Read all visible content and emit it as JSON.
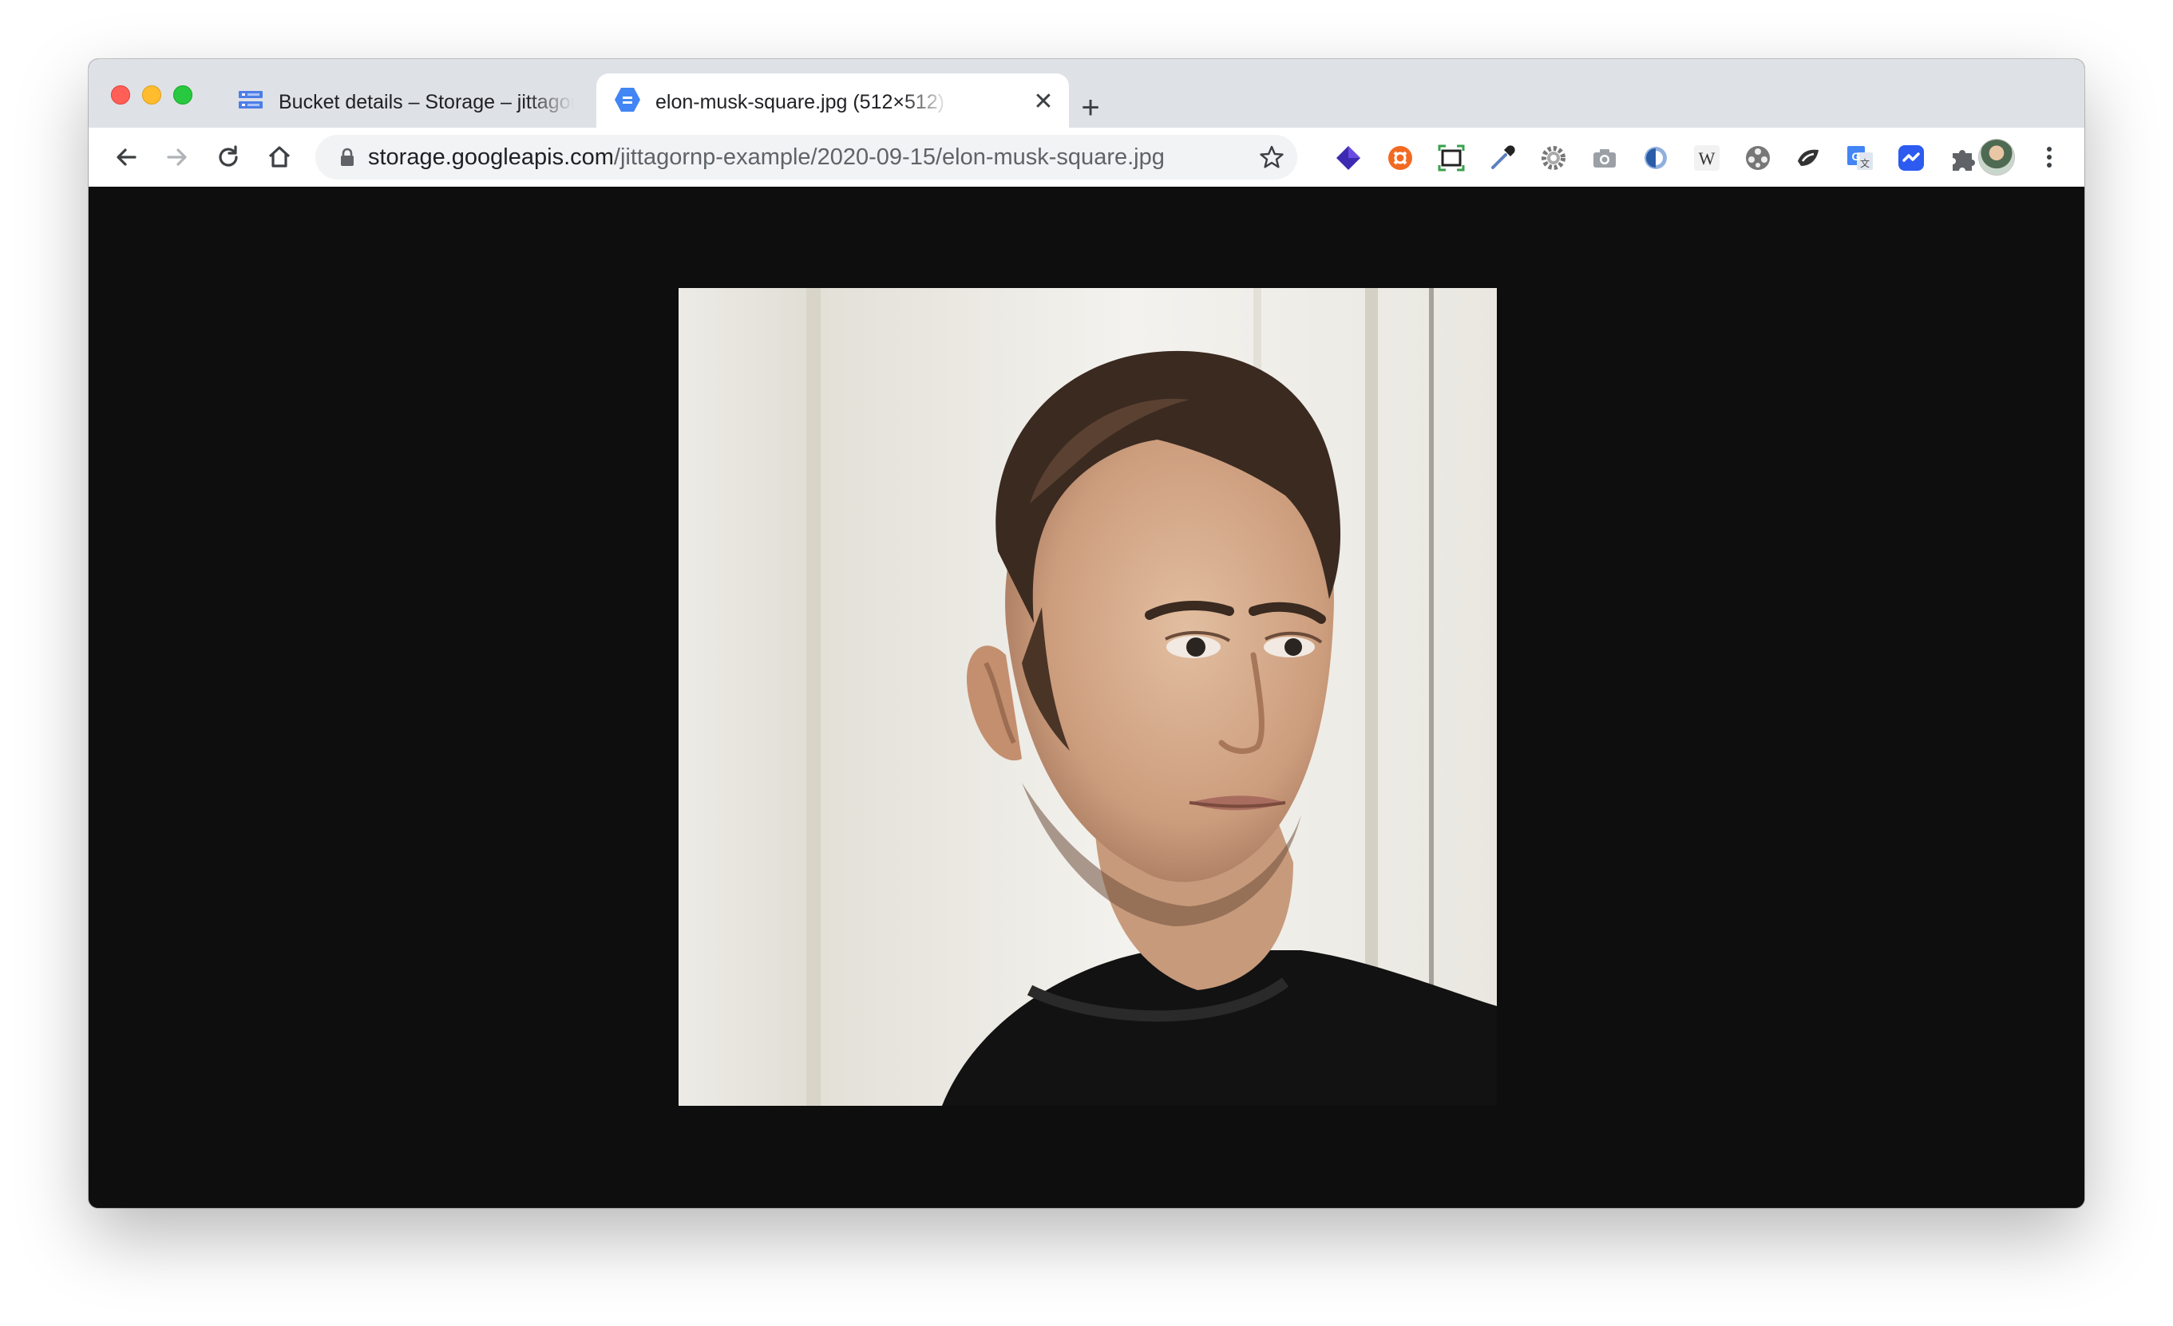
{
  "browser": {
    "window_controls": [
      "close",
      "minimize",
      "maximize"
    ],
    "tabs": [
      {
        "title": "Bucket details – Storage – jittagornp",
        "favicon": "cloud-storage-icon",
        "active": false
      },
      {
        "title": "elon-musk-square.jpg (512×512)",
        "favicon": "image-file-icon",
        "active": true
      }
    ],
    "new_tab_symbol": "+",
    "tab_close_symbol": "✕",
    "toolbar": {
      "back_icon": "back-arrow-icon",
      "forward_icon": "forward-arrow-icon",
      "reload_icon": "reload-icon",
      "home_icon": "home-icon",
      "address": {
        "host": "storage.googleapis.com",
        "path": "/jittagornp-example/2020-09-15/elon-musk-square.jpg"
      },
      "bookmark_icon": "star-icon",
      "extensions": [
        "layers-extension-icon",
        "orange-circle-extension-icon",
        "screenshot-frame-extension-icon",
        "color-picker-extension-icon",
        "gear-extension-icon",
        "camera-extension-icon",
        "blue-ring-extension-icon",
        "wikipedia-extension-icon",
        "film-reel-extension-icon",
        "sketch-extension-icon",
        "google-translate-extension-icon",
        "blue-chat-extension-icon",
        "puzzle-extensions-icon"
      ],
      "profile": "profile-avatar",
      "menu_icon": "kebab-menu-icon"
    }
  },
  "content": {
    "image_description": "portrait-photo",
    "background": "#0e0e0e"
  },
  "colors": {
    "tabstrip": "#dee1e6",
    "toolbar": "#ffffff",
    "omnibox": "#f1f3f4",
    "accent_blue": "#4285f4"
  }
}
